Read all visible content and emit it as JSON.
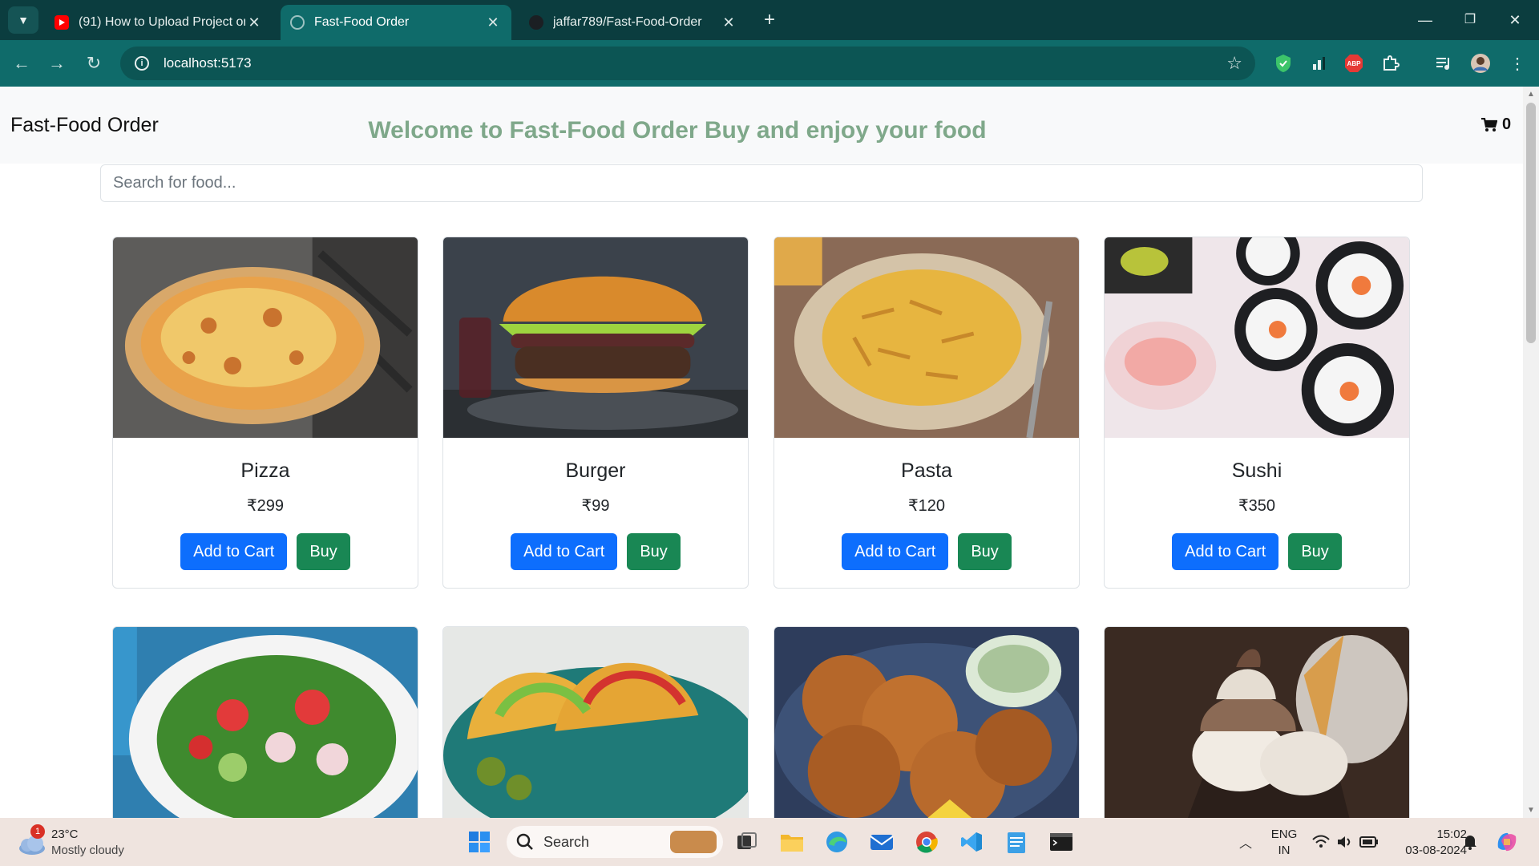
{
  "browser": {
    "tabs": [
      {
        "title": "(91) How to Upload Project on GitHub",
        "favicon": "youtube-icon"
      },
      {
        "title": "Fast-Food Order",
        "favicon": "globe-icon"
      },
      {
        "title": "jaffar789/Fast-Food-Order",
        "favicon": "github-icon"
      }
    ],
    "url": "localhost:5173"
  },
  "app": {
    "brand": "Fast-Food Order",
    "welcome": "Welcome to Fast-Food Order Buy and enjoy your food",
    "cart_count": "0",
    "search_placeholder": "Search for food...",
    "add_to_cart_label": "Add to Cart",
    "buy_label": "Buy",
    "items": [
      {
        "name": "Pizza",
        "price": "₹299",
        "image": "pizza-image"
      },
      {
        "name": "Burger",
        "price": "₹99",
        "image": "burger-image"
      },
      {
        "name": "Pasta",
        "price": "₹120",
        "image": "pasta-image"
      },
      {
        "name": "Sushi",
        "price": "₹350",
        "image": "sushi-image"
      },
      {
        "name": "",
        "price": "",
        "image": "salad-image"
      },
      {
        "name": "",
        "price": "",
        "image": "tacos-image"
      },
      {
        "name": "",
        "price": "",
        "image": "fried-chicken-image"
      },
      {
        "name": "",
        "price": "",
        "image": "ice-cream-image"
      }
    ]
  },
  "taskbar": {
    "weather_temp": "23°C",
    "weather_desc": "Mostly cloudy",
    "weather_badge": "1",
    "search_label": "Search",
    "lang_line1": "ENG",
    "lang_line2": "IN",
    "time": "15:02",
    "date": "03-08-2024"
  },
  "colors": {
    "tab_strip": "#0b3d3f",
    "toolbar": "#0f6b6a",
    "welcome_text": "#7fa88a",
    "primary_button": "#0d6efd",
    "success_button": "#198754"
  }
}
